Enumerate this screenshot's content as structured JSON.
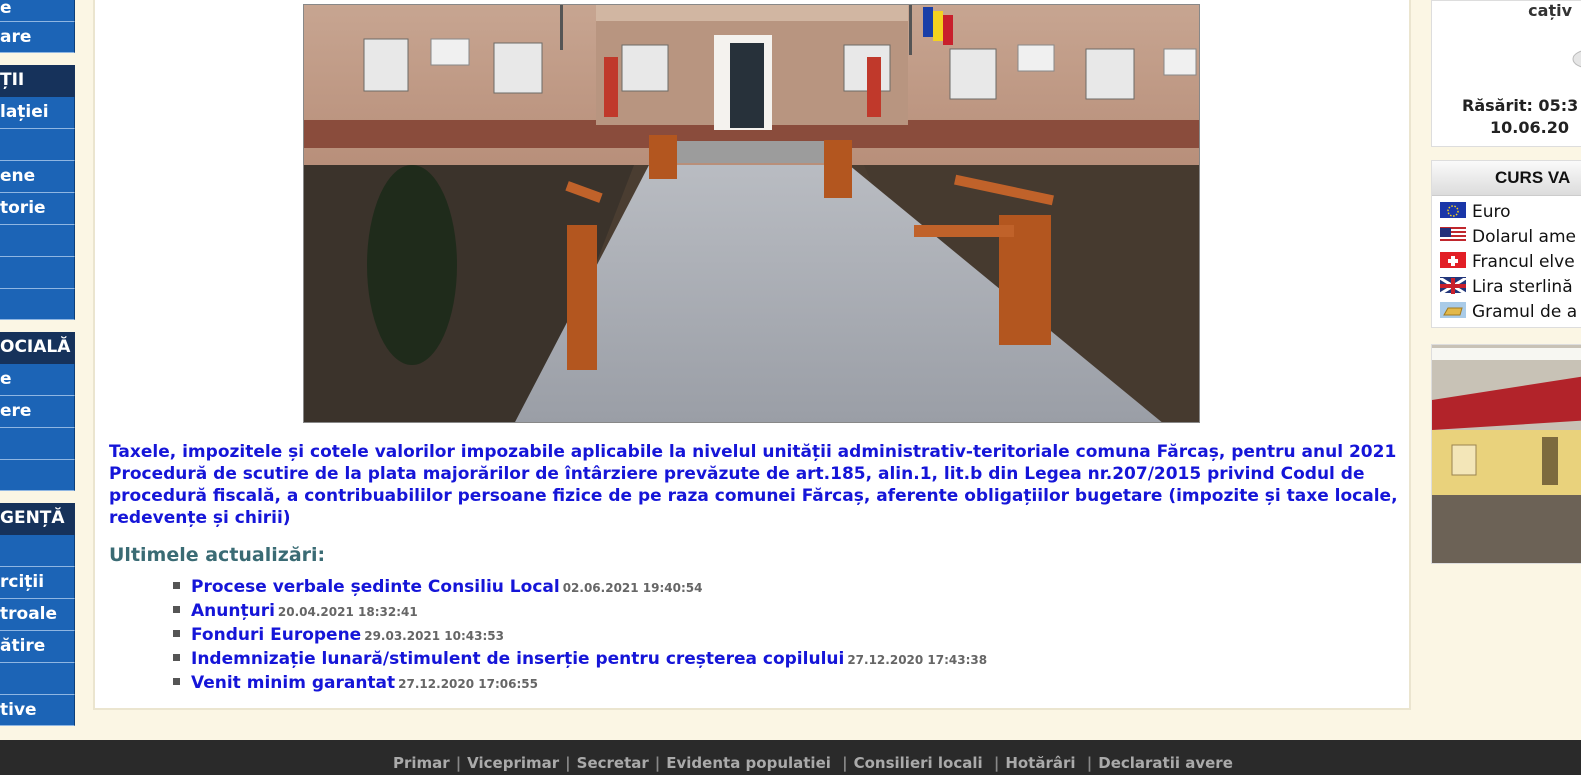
{
  "left_nav": [
    {
      "type": "item",
      "label": "e"
    },
    {
      "type": "item",
      "label": "are"
    },
    {
      "type": "head",
      "label": "ȚII"
    },
    {
      "type": "item",
      "label": "lației"
    },
    {
      "type": "item",
      "label": ""
    },
    {
      "type": "item",
      "label": "ene"
    },
    {
      "type": "item",
      "label": "torie"
    },
    {
      "type": "item",
      "label": ""
    },
    {
      "type": "item",
      "label": ""
    },
    {
      "type": "item",
      "label": ""
    },
    {
      "type": "head",
      "label": "OCIALĂ"
    },
    {
      "type": "item",
      "label": "e"
    },
    {
      "type": "item",
      "label": "ere"
    },
    {
      "type": "item",
      "label": ""
    },
    {
      "type": "item",
      "label": ""
    },
    {
      "type": "head",
      "label": "GENȚĂ"
    },
    {
      "type": "item",
      "label": ""
    },
    {
      "type": "item",
      "label": "rciții"
    },
    {
      "type": "item",
      "label": "troale"
    },
    {
      "type": "item",
      "label": "ătire"
    },
    {
      "type": "item",
      "label": ""
    },
    {
      "type": "item",
      "label": "tive"
    }
  ],
  "news_links": [
    "Taxele, impozitele și cotele valorilor impozabile aplicabile la nivelul unității administrativ-teritoriale comuna Fărcaș, pentru anul 2021",
    "Procedură de scutire de la plata majorărilor de întârziere prevăzute de art.185, alin.1, lit.b din Legea nr.207/2015 privind Codul de procedură fiscală, a contribuabililor persoane fizice de pe raza comunei Fărcaș, aferente obligațiilor bugetare (impozite și taxe locale, redevențe și chirii)"
  ],
  "updates": {
    "title": "Ultimele actualizări:",
    "items": [
      {
        "label": "Procese verbale ședinte Consiliu Local",
        "date": "02.06.2021 19:40:54"
      },
      {
        "label": "Anunțuri",
        "date": "20.04.2021 18:32:41"
      },
      {
        "label": "Fonduri Europene",
        "date": "29.03.2021 10:43:53"
      },
      {
        "label": "Indemnizație lunară/stimulent de inserție pentru creșterea copilului",
        "date": "27.12.2020 17:43:38"
      },
      {
        "label": "Venit minim garantat",
        "date": "27.12.2020 17:06:55"
      }
    ]
  },
  "weather": {
    "top_text": "cațiv",
    "sunrise": "Răsărit: 05:3",
    "date": "10.06.20"
  },
  "curs_valutar": {
    "title": "CURS VA",
    "rows": [
      {
        "flag": "eu-flag-icon",
        "label": "Euro"
      },
      {
        "flag": "us-flag-icon",
        "label": "Dolarul ame"
      },
      {
        "flag": "ch-flag-icon",
        "label": "Francul elve"
      },
      {
        "flag": "uk-flag-icon",
        "label": "Lira sterlină"
      },
      {
        "flag": "gold-icon",
        "label": "Gramul de a"
      }
    ]
  },
  "footer_links": [
    "Primar",
    "Viceprimar",
    "Secretar",
    "Evidenta populatiei",
    "Consilieri locali",
    "Hotărâri",
    "Declaratii avere"
  ],
  "colors": {
    "nav_blue": "#1c64b6",
    "nav_dark": "#16325b",
    "link_blue": "#1515d8",
    "heading_teal": "#3a6b74",
    "page_bg": "#fbf6e4",
    "footer_bg": "#2a2a2a"
  }
}
